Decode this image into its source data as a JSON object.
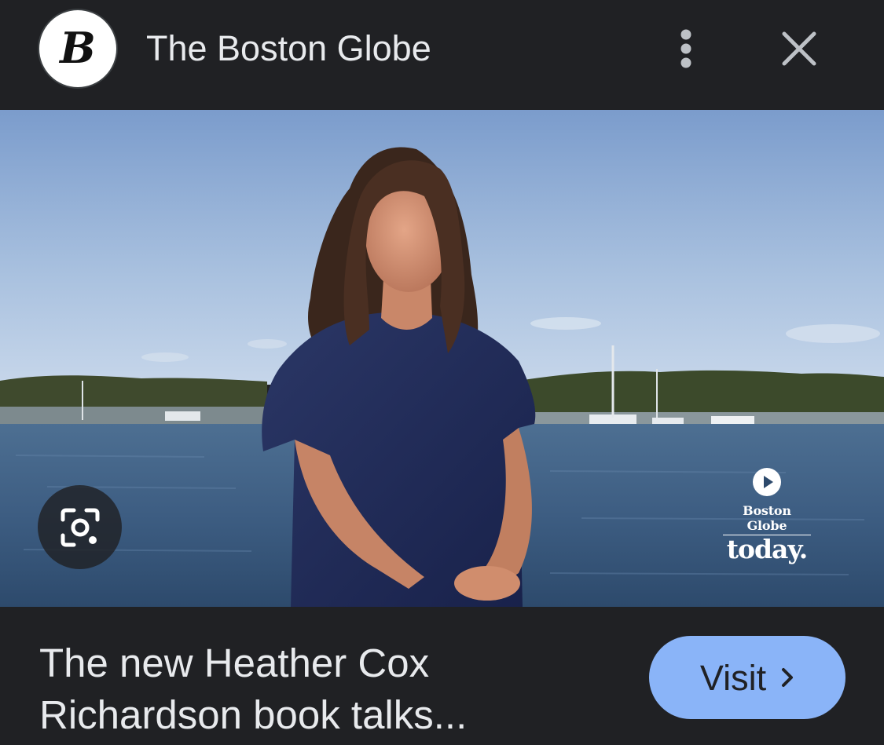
{
  "header": {
    "logo_letter": "B",
    "site_name": "The Boston Globe",
    "more_icon": "more-vert-icon",
    "close_icon": "close-icon"
  },
  "image": {
    "description_icon": "google-lens-icon",
    "watermark": {
      "play_icon": "play-icon",
      "brand": "Boston Globe",
      "tagline": "today."
    }
  },
  "footer": {
    "headline_line1": "The new Heather Cox",
    "headline_line2": "Richardson book talks...",
    "visit_label": "Visit",
    "visit_icon": "chevron-right-icon"
  },
  "colors": {
    "background": "#202124",
    "text": "#e8eaed",
    "accent": "#8ab4f8"
  }
}
